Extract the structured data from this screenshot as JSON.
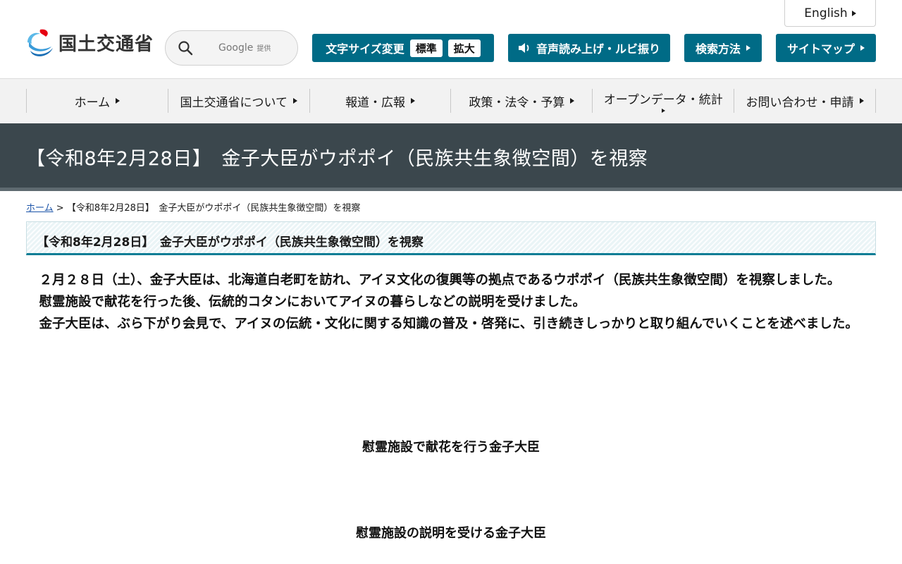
{
  "header": {
    "english_label": "English",
    "logo_text": "国土交通省",
    "search": {
      "brand": "Google",
      "brand_suffix": "提供"
    },
    "text_size": {
      "label": "文字サイズ変更",
      "standard": "標準",
      "large": "拡大"
    },
    "voice_label": "音声読み上げ・ルビ振り",
    "search_method_label": "検索方法",
    "sitemap_label": "サイトマップ"
  },
  "nav": {
    "items": [
      {
        "label": "ホーム"
      },
      {
        "label": "国土交通省について"
      },
      {
        "label": "報道・広報"
      },
      {
        "label": "政策・法令・予算"
      },
      {
        "label": "オープンデータ・統計"
      },
      {
        "label": "お問い合わせ・申請"
      }
    ]
  },
  "page": {
    "title": "【令和8年2月28日】　金子大臣がウポポイ（民族共生象徴空間）を視察",
    "heading": "【令和8年2月28日】　金子大臣がウポポイ（民族共生象徴空間）を視察"
  },
  "breadcrumb": {
    "home": "ホーム",
    "separator": ">",
    "current": "【令和8年2月28日】　金子大臣がウポポイ（民族共生象徴空間）を視察"
  },
  "article": {
    "paragraphs": [
      "２月２８日（土）、金子大臣は、北海道白老町を訪れ、アイヌ文化の復興等の拠点であるウポポイ（民族共生象徴空間）を視察しました。",
      "慰霊施設で献花を行った後、伝統的コタンにおいてアイヌの暮らしなどの説明を受けました。",
      "金子大臣は、ぶら下がり会見で、アイヌの伝統・文化に関する知識の普及・啓発に、引き続きしっかりと取り組んでいくことを述べました。"
    ],
    "captions": [
      "慰霊施設で献花を行う金子大臣",
      "慰霊施設の説明を受ける金子大臣"
    ]
  },
  "colors": {
    "brand_teal": "#006b86",
    "title_band": "#3b474d",
    "nav_bg": "#f2f2f2",
    "link": "#1a53a8"
  },
  "icons": [
    "logo-mark-icon",
    "search-icon",
    "speaker-icon",
    "triangle-right-icon"
  ]
}
